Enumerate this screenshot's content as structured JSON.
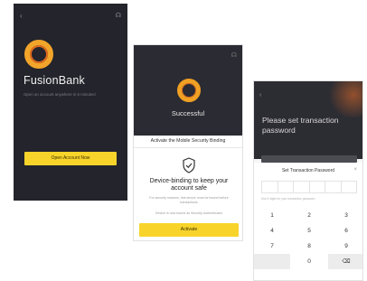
{
  "screen1": {
    "brand": "FusionBank",
    "tagline": "Open an account anywhere in 5 minutes!",
    "cta": "Open Account Now"
  },
  "screen2": {
    "status": "Successful",
    "sheet_title": "Activate the Mobile Security Binding",
    "headline": "Device-binding to keep your account safe",
    "subtitle": "For security reasons, this device must be bound before transactions",
    "subtitle2": "Device is now bound as Security Authenticator",
    "button": "Activate"
  },
  "screen3": {
    "title": "Please set transaction password",
    "panel_title": "Set Transaction Password",
    "hint": "Use 6 digits for your transaction password",
    "keys": [
      "1",
      "2",
      "3",
      "4",
      "5",
      "6",
      "7",
      "8",
      "9",
      "",
      "0"
    ]
  },
  "colors": {
    "dark": "#24242c",
    "accent": "#f8d42b",
    "brand_ring": "#f2a52a"
  },
  "icons": {
    "back": "chevron-left-icon",
    "support": "headset-icon",
    "shield": "shield-check-icon",
    "delete": "backspace-icon"
  }
}
